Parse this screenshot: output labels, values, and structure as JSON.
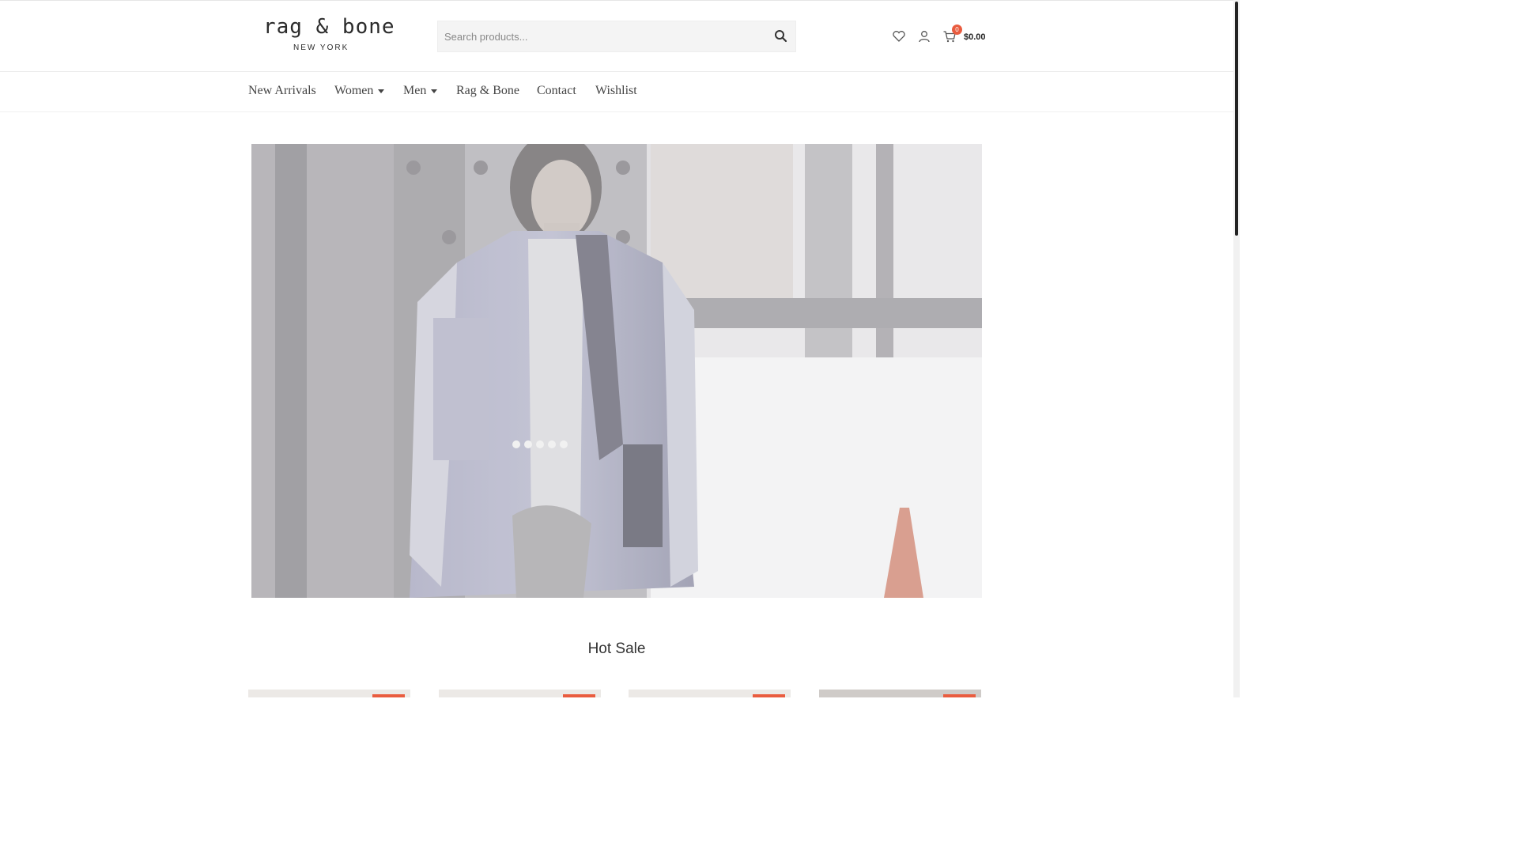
{
  "logo": {
    "main": "rag & bone",
    "sub": "NEW YORK"
  },
  "search": {
    "placeholder": "Search products..."
  },
  "header_icons": [
    "wishlist-heart-icon",
    "user-account-icon",
    "cart-icon"
  ],
  "cart": {
    "count": "0",
    "total": "$0.00"
  },
  "nav": {
    "items": [
      {
        "label": "New Arrivals",
        "has_dropdown": false
      },
      {
        "label": "Women",
        "has_dropdown": true
      },
      {
        "label": "Men",
        "has_dropdown": true
      },
      {
        "label": "Rag & Bone",
        "has_dropdown": false
      },
      {
        "label": "Contact",
        "has_dropdown": false
      },
      {
        "label": "Wishlist",
        "has_dropdown": false
      }
    ]
  },
  "hot_sale": {
    "title": "Hot Sale"
  },
  "colors": {
    "accent": "#e95c3f",
    "text": "#333333",
    "search_bg": "#f4f4f4"
  }
}
